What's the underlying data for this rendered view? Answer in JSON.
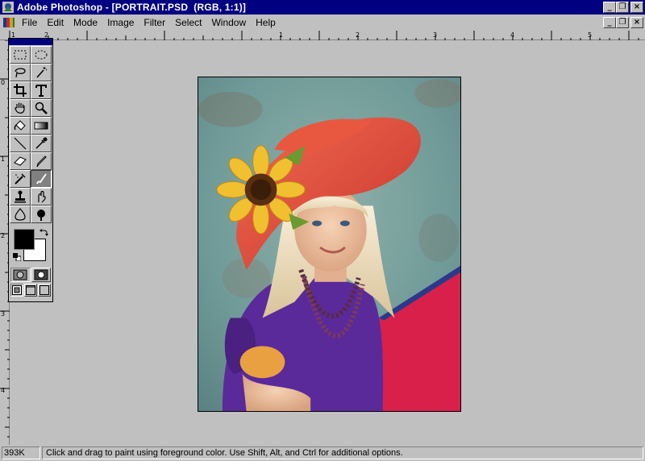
{
  "window": {
    "title": "Adobe Photoshop - [PORTRAIT.PSD  (RGB, 1:1)]",
    "controls": {
      "minimize": "_",
      "restore": "❐",
      "close": "×"
    }
  },
  "menubar": {
    "items": [
      "File",
      "Edit",
      "Mode",
      "Image",
      "Filter",
      "Select",
      "Window",
      "Help"
    ],
    "doc_controls": {
      "minimize": "_",
      "restore": "❐",
      "close": "×"
    }
  },
  "rulers": {
    "horizontal_labels": [
      "1",
      "2",
      "1",
      "2",
      "3",
      "4",
      "5"
    ],
    "vertical_labels": [
      "0",
      "1",
      "2",
      "3",
      "4"
    ]
  },
  "toolbox": {
    "tools": [
      {
        "name": "marquee-rect-tool",
        "icon": "rect-marquee-icon"
      },
      {
        "name": "marquee-ellipse-tool",
        "icon": "ellipse-marquee-icon"
      },
      {
        "name": "lasso-tool",
        "icon": "lasso-icon"
      },
      {
        "name": "magic-wand-tool",
        "icon": "magic-wand-icon"
      },
      {
        "name": "crop-tool",
        "icon": "crop-icon"
      },
      {
        "name": "type-tool",
        "icon": "type-icon"
      },
      {
        "name": "hand-tool",
        "icon": "hand-icon"
      },
      {
        "name": "zoom-tool",
        "icon": "zoom-icon"
      },
      {
        "name": "paint-bucket-tool",
        "icon": "paint-bucket-icon"
      },
      {
        "name": "gradient-tool",
        "icon": "gradient-icon"
      },
      {
        "name": "line-tool",
        "icon": "line-icon"
      },
      {
        "name": "eyedropper-tool",
        "icon": "eyedropper-icon"
      },
      {
        "name": "eraser-tool",
        "icon": "eraser-icon"
      },
      {
        "name": "pencil-tool",
        "icon": "pencil-icon"
      },
      {
        "name": "airbrush-tool",
        "icon": "airbrush-icon"
      },
      {
        "name": "paintbrush-tool",
        "icon": "paintbrush-icon"
      },
      {
        "name": "rubber-stamp-tool",
        "icon": "rubber-stamp-icon"
      },
      {
        "name": "smudge-tool",
        "icon": "smudge-icon"
      },
      {
        "name": "blur-tool",
        "icon": "blur-icon"
      },
      {
        "name": "dodge-burn-tool",
        "icon": "dodge-burn-icon"
      }
    ],
    "active_tool": "paintbrush-tool",
    "foreground_color": "#000000",
    "background_color": "#ffffff"
  },
  "canvas": {
    "document": "PORTRAIT.PSD"
  },
  "status": {
    "doc_size": "393K",
    "message": "Click and drag to paint using foreground color. Use Shift, Alt, and Ctrl for additional options."
  }
}
